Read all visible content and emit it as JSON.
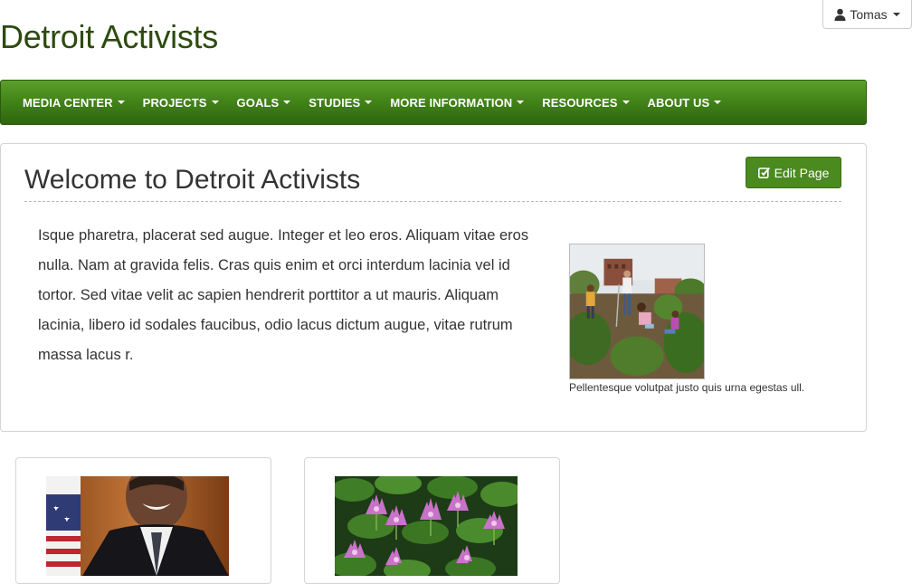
{
  "site": {
    "title": "Detroit Activists"
  },
  "user_menu": {
    "name": "Tomas"
  },
  "nav": {
    "items": [
      {
        "label": "MEDIA CENTER"
      },
      {
        "label": "PROJECTS"
      },
      {
        "label": "GOALS"
      },
      {
        "label": "STUDIES"
      },
      {
        "label": "MORE INFORMATION"
      },
      {
        "label": "RESOURCES"
      },
      {
        "label": "ABOUT US"
      }
    ]
  },
  "main": {
    "heading": "Welcome to Detroit Activists",
    "edit_label": "Edit Page",
    "body": "Isque pharetra, placerat sed augue. Integer et leo eros. Aliquam vitae eros nulla. Nam at gravida felis. Cras quis enim et orci interdum lacinia vel id tortor. Sed vitae velit ac sapien hendrerit porttitor a ut mauris. Aliquam lacinia, libero id sodales faucibus, odio lacus dictum augue, vitae rutrum massa lacus r.",
    "photo_caption": "Pellentesque volutpat justo quis urna egestas ull."
  },
  "colors": {
    "brand_green": "#3f7f17",
    "title_green": "#2d4a0f",
    "button_green": "#4a8a1f"
  },
  "icons": {
    "user": "user-icon",
    "edit": "edit-icon",
    "caret": "caret-down-icon"
  }
}
